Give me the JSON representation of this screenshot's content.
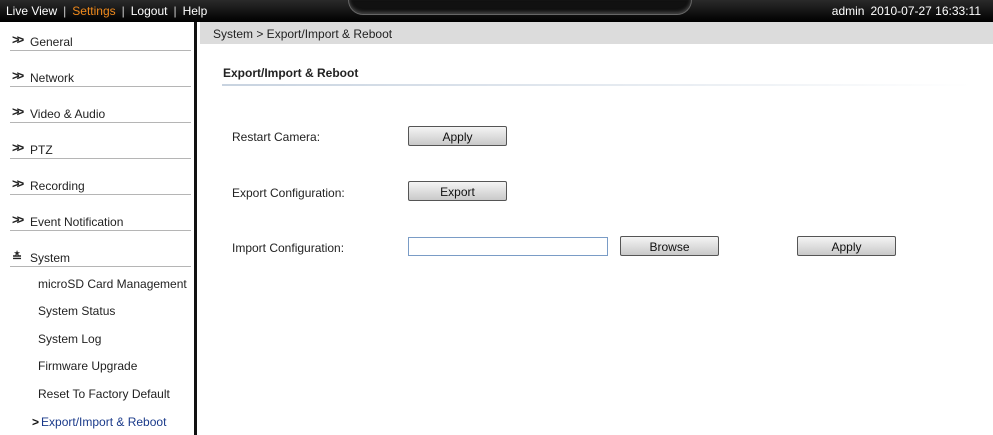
{
  "topbar": {
    "nav": [
      "Live View",
      "Settings",
      "Logout",
      "Help"
    ],
    "user": "admin",
    "datetime": "2010-07-27 16:33:11",
    "active_color": "#f08a1c"
  },
  "sidebar": {
    "categories": [
      {
        "label": "General",
        "icon": "double-chevron-right-icon"
      },
      {
        "label": "Network",
        "icon": "double-chevron-right-icon"
      },
      {
        "label": "Video & Audio",
        "icon": "double-chevron-right-icon"
      },
      {
        "label": "PTZ",
        "icon": "double-chevron-right-icon"
      },
      {
        "label": "Recording",
        "icon": "double-chevron-right-icon"
      },
      {
        "label": "Event Notification",
        "icon": "double-chevron-right-icon"
      },
      {
        "label": "System",
        "icon": "double-chevron-down-icon"
      }
    ],
    "system_items": [
      "microSD Card Management",
      "System Status",
      "System Log",
      "Firmware Upgrade",
      "Reset To Factory Default",
      "Export/Import & Reboot"
    ]
  },
  "breadcrumb": "System > Export/Import & Reboot",
  "main": {
    "title": "Export/Import & Reboot",
    "restart_label": "Restart Camera:",
    "restart_button": "Apply",
    "export_label": "Export Configuration:",
    "export_button": "Export",
    "import_label": "Import Configuration:",
    "import_value": "",
    "browse_button": "Browse",
    "import_apply_button": "Apply"
  }
}
